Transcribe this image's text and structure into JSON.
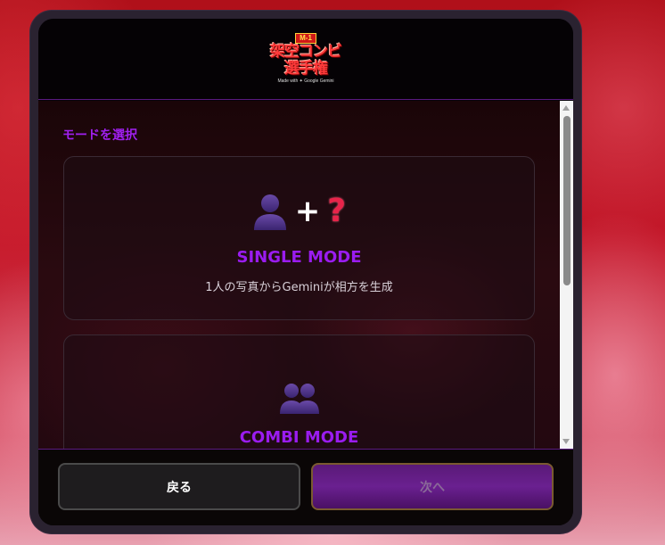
{
  "header": {
    "logo": {
      "badge": "M-1",
      "line1": "架空コンビ",
      "line2": "選手権",
      "sub": "Made with ✦ Google Gemini"
    }
  },
  "content": {
    "section_label": "モードを選択",
    "modes": [
      {
        "title": "SINGLE MODE",
        "description": "1人の写真からGeminiが相方を生成",
        "icons": [
          "person-icon",
          "plus-icon",
          "question-mark-icon"
        ]
      },
      {
        "title": "COMBI MODE",
        "description": "",
        "icons": [
          "two-persons-icon"
        ]
      }
    ]
  },
  "footer": {
    "back_label": "戻る",
    "next_label": "次へ"
  },
  "icons": {
    "plus": "+",
    "question": "?"
  },
  "colors": {
    "accent_purple": "#9a1cf0",
    "question_red": "#e8244a",
    "person_purple": "#5a3a9a"
  }
}
